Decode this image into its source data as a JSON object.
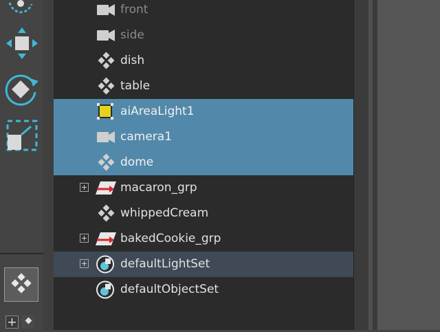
{
  "outliner": {
    "items": [
      {
        "label": "front",
        "icon": "camera-icon",
        "dim": true,
        "state": "normal",
        "expandable": false
      },
      {
        "label": "side",
        "icon": "camera-icon",
        "dim": true,
        "state": "normal",
        "expandable": false
      },
      {
        "label": "dish",
        "icon": "mesh-transform-icon",
        "dim": false,
        "state": "normal",
        "expandable": false
      },
      {
        "label": "table",
        "icon": "mesh-transform-icon",
        "dim": false,
        "state": "normal",
        "expandable": false
      },
      {
        "label": "aiAreaLight1",
        "icon": "area-light-icon",
        "dim": false,
        "state": "selected",
        "expandable": false
      },
      {
        "label": "camera1",
        "icon": "camera-icon",
        "dim": false,
        "state": "selected",
        "expandable": false
      },
      {
        "label": "dome",
        "icon": "mesh-transform-icon",
        "dim": false,
        "state": "selected",
        "expandable": false
      },
      {
        "label": "macaron_grp",
        "icon": "group-icon",
        "dim": false,
        "state": "normal",
        "expandable": true
      },
      {
        "label": "whippedCream",
        "icon": "mesh-transform-icon",
        "dim": false,
        "state": "normal",
        "expandable": false
      },
      {
        "label": "bakedCookie_grp",
        "icon": "group-icon",
        "dim": false,
        "state": "normal",
        "expandable": true
      },
      {
        "label": "defaultLightSet",
        "icon": "object-set-icon",
        "dim": false,
        "state": "highlight",
        "expandable": true
      },
      {
        "label": "defaultObjectSet",
        "icon": "object-set-icon",
        "dim": false,
        "state": "normal",
        "expandable": false
      }
    ]
  },
  "colors": {
    "selection": "#5289aa",
    "hover_row": "#3f4a56",
    "outliner_bg": "#2b2b2b",
    "tool_accent": "#3fb8d6"
  },
  "toolbox": {
    "tools": [
      "lasso-select-icon",
      "move-tool-icon",
      "rotate-tool-icon",
      "scale-tool-icon"
    ],
    "bottom": [
      "layout-quad-icon",
      "add-icon",
      "layout-small-icon"
    ]
  }
}
